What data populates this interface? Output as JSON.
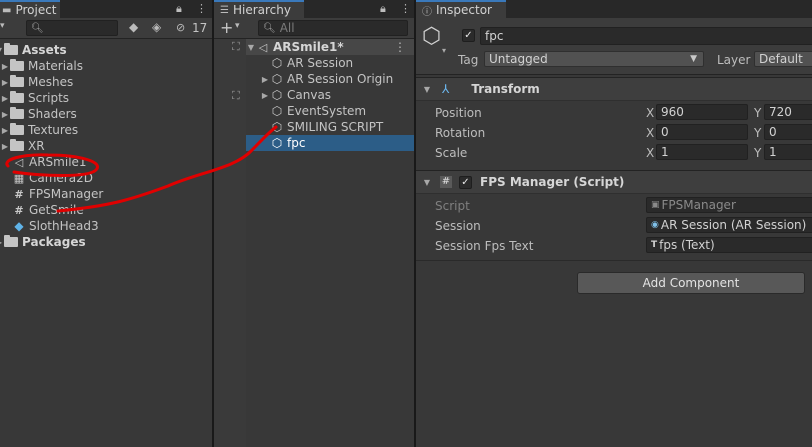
{
  "project": {
    "tab_label": "Project",
    "search_placeholder": "",
    "hidden_count": "17",
    "assets_label": "Assets",
    "folders": [
      "Materials",
      "Meshes",
      "Scripts",
      "Shaders",
      "Textures",
      "XR"
    ],
    "files": [
      {
        "name": "ARSmile1",
        "icon": "unity-scene-icon"
      },
      {
        "name": "Camera2D",
        "icon": "checker-asset-icon"
      },
      {
        "name": "FPSManager",
        "icon": "csharp-script-icon"
      },
      {
        "name": "GetSmile",
        "icon": "csharp-script-icon"
      },
      {
        "name": "SlothHead3",
        "icon": "model-prefab-icon"
      }
    ],
    "packages_label": "Packages"
  },
  "hierarchy": {
    "tab_label": "Hierarchy",
    "add_label": "+",
    "search_placeholder": "All",
    "scene_name": "ARSmile1*",
    "items": [
      {
        "name": "AR Session",
        "has_children": false
      },
      {
        "name": "AR Session Origin",
        "has_children": true
      },
      {
        "name": "Canvas",
        "has_children": true
      },
      {
        "name": "EventSystem",
        "has_children": false
      },
      {
        "name": "SMILING SCRIPT",
        "has_children": false
      },
      {
        "name": "fpc",
        "has_children": false
      }
    ],
    "selected_index": 5
  },
  "inspector": {
    "tab_label": "Inspector",
    "object_name": "fpc",
    "tag_label": "Tag",
    "tag_value": "Untagged",
    "layer_label": "Layer",
    "layer_value": "Default",
    "transform": {
      "title": "Transform",
      "position_label": "Position",
      "rotation_label": "Rotation",
      "scale_label": "Scale",
      "x_label": "X",
      "y_label": "Y",
      "position": {
        "x": "960",
        "y": "720"
      },
      "rotation": {
        "x": "0",
        "y": "0"
      },
      "scale": {
        "x": "1",
        "y": "1"
      }
    },
    "fps_manager": {
      "title": "FPS Manager (Script)",
      "script_label": "Script",
      "script_value": "FPSManager",
      "session_label": "Session",
      "session_value": "AR Session (AR Session)",
      "fps_label": "Session Fps Text",
      "fps_value": "fps (Text)"
    },
    "add_component_label": "Add Component"
  },
  "colors": {
    "selection": "#2c5d87",
    "annotation": "#e00000",
    "tab_accent": "#3a79bb"
  }
}
